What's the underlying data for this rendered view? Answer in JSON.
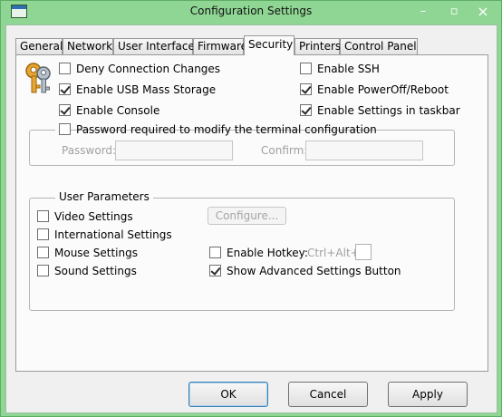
{
  "window": {
    "title": "Configuration Settings",
    "minimize": "–",
    "maximize": "▫",
    "close": "×"
  },
  "tabs": [
    {
      "label": "General"
    },
    {
      "label": "Network"
    },
    {
      "label": "User Interface"
    },
    {
      "label": "Firmware"
    },
    {
      "label": "Security",
      "active": true
    },
    {
      "label": "Printers"
    },
    {
      "label": "Control Panel"
    }
  ],
  "security": {
    "deny_connection_changes": {
      "label": "Deny Connection Changes",
      "checked": false
    },
    "enable_usb_mass_storage": {
      "label": "Enable USB Mass Storage",
      "checked": true
    },
    "enable_console": {
      "label": "Enable Console",
      "checked": true
    },
    "enable_ssh": {
      "label": "Enable SSH",
      "checked": false
    },
    "enable_poweroff_reboot": {
      "label": "Enable PowerOff/Reboot",
      "checked": true
    },
    "enable_settings_taskbar": {
      "label": "Enable Settings in taskbar",
      "checked": true
    },
    "password_required": {
      "label": "Password required to modify the terminal configuration",
      "checked": false
    },
    "password_label": "Password:",
    "password_value": "",
    "confirm_label": "Confirm:",
    "confirm_value": ""
  },
  "user_parameters": {
    "title": "User Parameters",
    "video_settings": {
      "label": "Video Settings",
      "checked": false
    },
    "international_settings": {
      "label": "International Settings",
      "checked": false
    },
    "mouse_settings": {
      "label": "Mouse Settings",
      "checked": false
    },
    "sound_settings": {
      "label": "Sound Settings",
      "checked": false
    },
    "configure_label": "Configure...",
    "enable_hotkey": {
      "label": "Enable Hotkey:",
      "checked": false
    },
    "hotkey_prefix": "Ctrl+Alt+",
    "hotkey_value": "",
    "show_advanced": {
      "label": "Show Advanced Settings Button",
      "checked": true
    }
  },
  "buttons": {
    "ok": "OK",
    "cancel": "Cancel",
    "apply": "Apply"
  },
  "icons": {
    "app": "window-icon",
    "security": "keys-icon"
  },
  "colors": {
    "titlebar": "#8fd694",
    "panel": "#fbfbfb",
    "default_button_border": "#3c7fb1"
  }
}
